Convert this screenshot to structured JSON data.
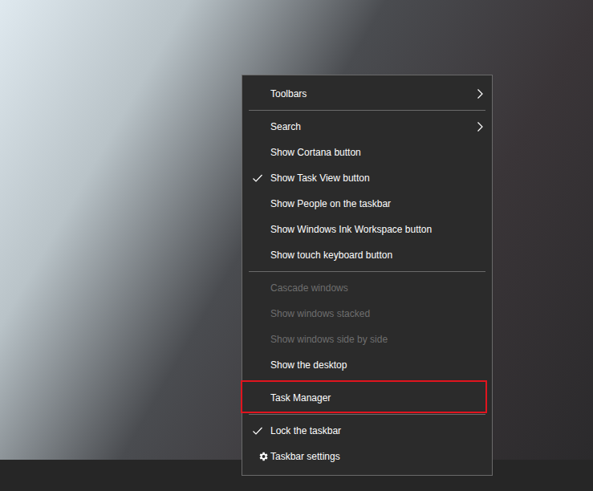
{
  "desktop": {
    "wallpaper": "photo"
  },
  "menu": {
    "items": [
      {
        "kind": "item",
        "label": "Toolbars",
        "checked": false,
        "disabled": false,
        "submenu": true,
        "highlighted": false
      },
      {
        "kind": "separator"
      },
      {
        "kind": "item",
        "label": "Search",
        "checked": false,
        "disabled": false,
        "submenu": true,
        "highlighted": false
      },
      {
        "kind": "item",
        "label": "Show Cortana button",
        "checked": false,
        "disabled": false,
        "submenu": false,
        "highlighted": false
      },
      {
        "kind": "item",
        "label": "Show Task View button",
        "checked": true,
        "disabled": false,
        "submenu": false,
        "highlighted": false
      },
      {
        "kind": "item",
        "label": "Show People on the taskbar",
        "checked": false,
        "disabled": false,
        "submenu": false,
        "highlighted": false
      },
      {
        "kind": "item",
        "label": "Show Windows Ink Workspace button",
        "checked": false,
        "disabled": false,
        "submenu": false,
        "highlighted": false
      },
      {
        "kind": "item",
        "label": "Show touch keyboard button",
        "checked": false,
        "disabled": false,
        "submenu": false,
        "highlighted": false
      },
      {
        "kind": "separator"
      },
      {
        "kind": "item",
        "label": "Cascade windows",
        "checked": false,
        "disabled": true,
        "submenu": false,
        "highlighted": false
      },
      {
        "kind": "item",
        "label": "Show windows stacked",
        "checked": false,
        "disabled": true,
        "submenu": false,
        "highlighted": false
      },
      {
        "kind": "item",
        "label": "Show windows side by side",
        "checked": false,
        "disabled": true,
        "submenu": false,
        "highlighted": false
      },
      {
        "kind": "item",
        "label": "Show the desktop",
        "checked": false,
        "disabled": false,
        "submenu": false,
        "highlighted": false
      },
      {
        "kind": "separator"
      },
      {
        "kind": "item",
        "label": "Task Manager",
        "checked": false,
        "disabled": false,
        "submenu": false,
        "highlighted": true
      },
      {
        "kind": "separator"
      },
      {
        "kind": "item",
        "label": "Lock the taskbar",
        "checked": true,
        "disabled": false,
        "submenu": false,
        "highlighted": false
      },
      {
        "kind": "settings",
        "label": "Taskbar settings",
        "checked": false,
        "disabled": false,
        "submenu": false,
        "highlighted": false
      }
    ]
  }
}
